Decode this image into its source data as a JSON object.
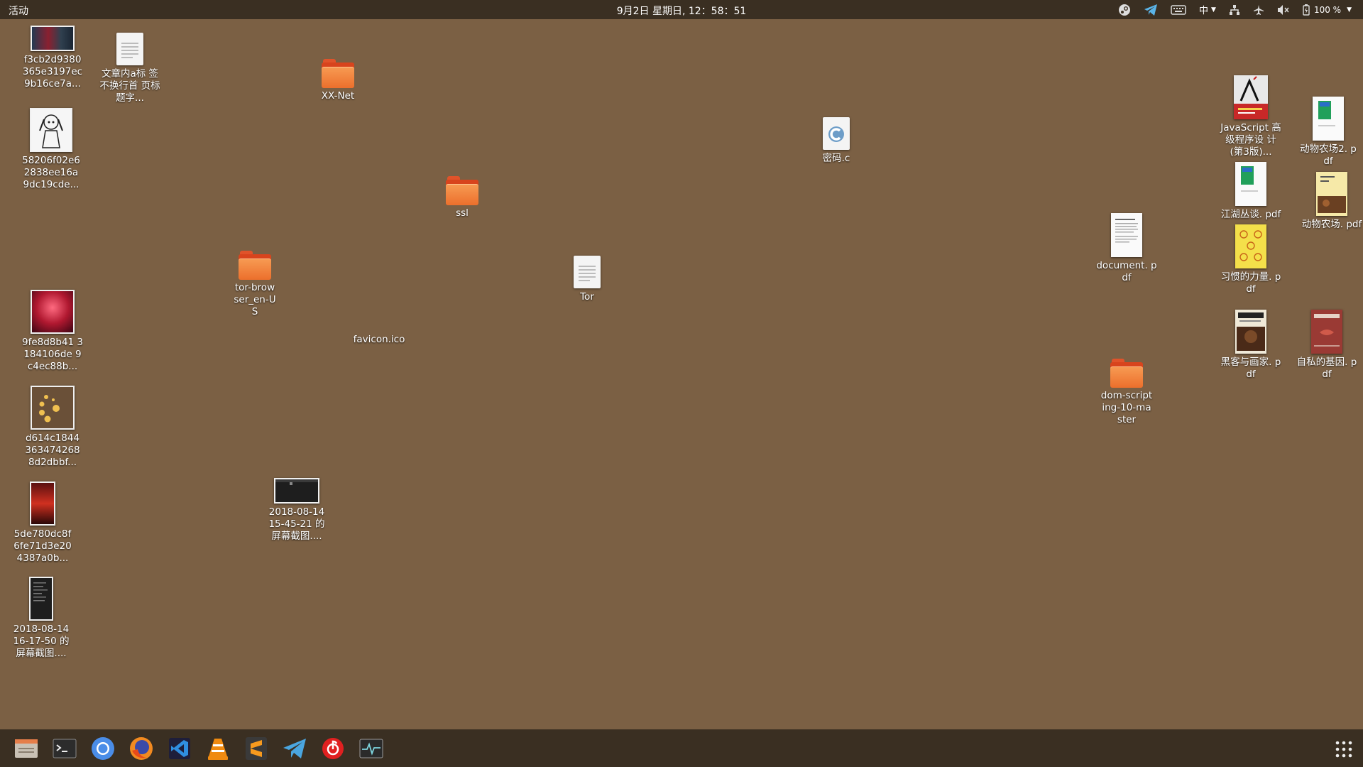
{
  "topbar": {
    "activities_label": "活动",
    "clock": "9月2日 星期日, 12：58：51",
    "input_method": "中",
    "battery_percent": "100 %"
  },
  "desktop": {
    "items": [
      {
        "id": "img1",
        "label": "f3cb2d9380 365e3197ec 9b16ce7a...",
        "icon": "image-thumbnail"
      },
      {
        "id": "doc1",
        "label": "文章内a标 签不换行首 页标题字...",
        "icon": "text-document-icon"
      },
      {
        "id": "img2",
        "label": "58206f02e6 2838ee16a 9dc19cde...",
        "icon": "image-thumbnail"
      },
      {
        "id": "img3",
        "label": "9fe8d8b41 3184106de 9c4ec88b...",
        "icon": "image-thumbnail"
      },
      {
        "id": "img4",
        "label": "d614c1844 363474268 8d2dbbf...",
        "icon": "image-thumbnail"
      },
      {
        "id": "img5",
        "label": "5de780dc8f 6fe71d3e20 4387a0b...",
        "icon": "image-thumbnail"
      },
      {
        "id": "img6",
        "label": "2018-08-14 16-17-50 的 屏幕截图....",
        "icon": "image-thumbnail"
      },
      {
        "id": "xxnet",
        "label": "XX-Net",
        "icon": "folder-icon"
      },
      {
        "id": "ssl",
        "label": "ssl",
        "icon": "folder-icon"
      },
      {
        "id": "tor_browser",
        "label": "tor-browser_en-US",
        "icon": "folder-icon"
      },
      {
        "id": "favicon",
        "label": "favicon.ico",
        "icon": "none"
      },
      {
        "id": "tor",
        "label": "Tor",
        "icon": "text-document-icon"
      },
      {
        "id": "mima",
        "label": "密码.c",
        "icon": "c-source-icon"
      },
      {
        "id": "screenshot1",
        "label": "2018-08-14 15-45-21 的 屏幕截图....",
        "icon": "image-thumbnail"
      },
      {
        "id": "document",
        "label": "document. pdf",
        "icon": "pdf-icon"
      },
      {
        "id": "dom",
        "label": "dom-scripting-10-master",
        "icon": "folder-icon"
      },
      {
        "id": "js_book",
        "label": "JavaScript 高级程序设 计(第3版)...",
        "icon": "pdf-icon"
      },
      {
        "id": "jianghu",
        "label": "江湖丛谈. pdf",
        "icon": "pdf-icon"
      },
      {
        "id": "xiguan",
        "label": "习惯的力量. pdf",
        "icon": "pdf-icon"
      },
      {
        "id": "heike",
        "label": "黑客与画家. pdf",
        "icon": "pdf-icon"
      },
      {
        "id": "animal2",
        "label": "动物农场2. pdf",
        "icon": "pdf-icon"
      },
      {
        "id": "animal",
        "label": "动物农场. pdf",
        "icon": "pdf-icon"
      },
      {
        "id": "selfish",
        "label": "自私的基因. pdf",
        "icon": "pdf-icon"
      }
    ]
  },
  "dock": {
    "items": [
      {
        "name": "files",
        "icon": "file-manager-icon"
      },
      {
        "name": "terminal",
        "icon": "terminal-icon"
      },
      {
        "name": "chromium",
        "icon": "chromium-icon"
      },
      {
        "name": "firefox",
        "icon": "firefox-icon"
      },
      {
        "name": "vscode",
        "icon": "vscode-icon"
      },
      {
        "name": "vlc",
        "icon": "vlc-icon"
      },
      {
        "name": "sublime",
        "icon": "sublime-text-icon"
      },
      {
        "name": "telegram",
        "icon": "telegram-icon"
      },
      {
        "name": "netease-music",
        "icon": "netease-music-icon"
      },
      {
        "name": "system-monitor",
        "icon": "system-monitor-icon"
      }
    ],
    "show_apps_icon": "app-grid-icon"
  },
  "colors": {
    "desktop_bg": "#7b6044",
    "panel_bg": "#3a2f22",
    "folder_orange": "#ec6f2c"
  }
}
